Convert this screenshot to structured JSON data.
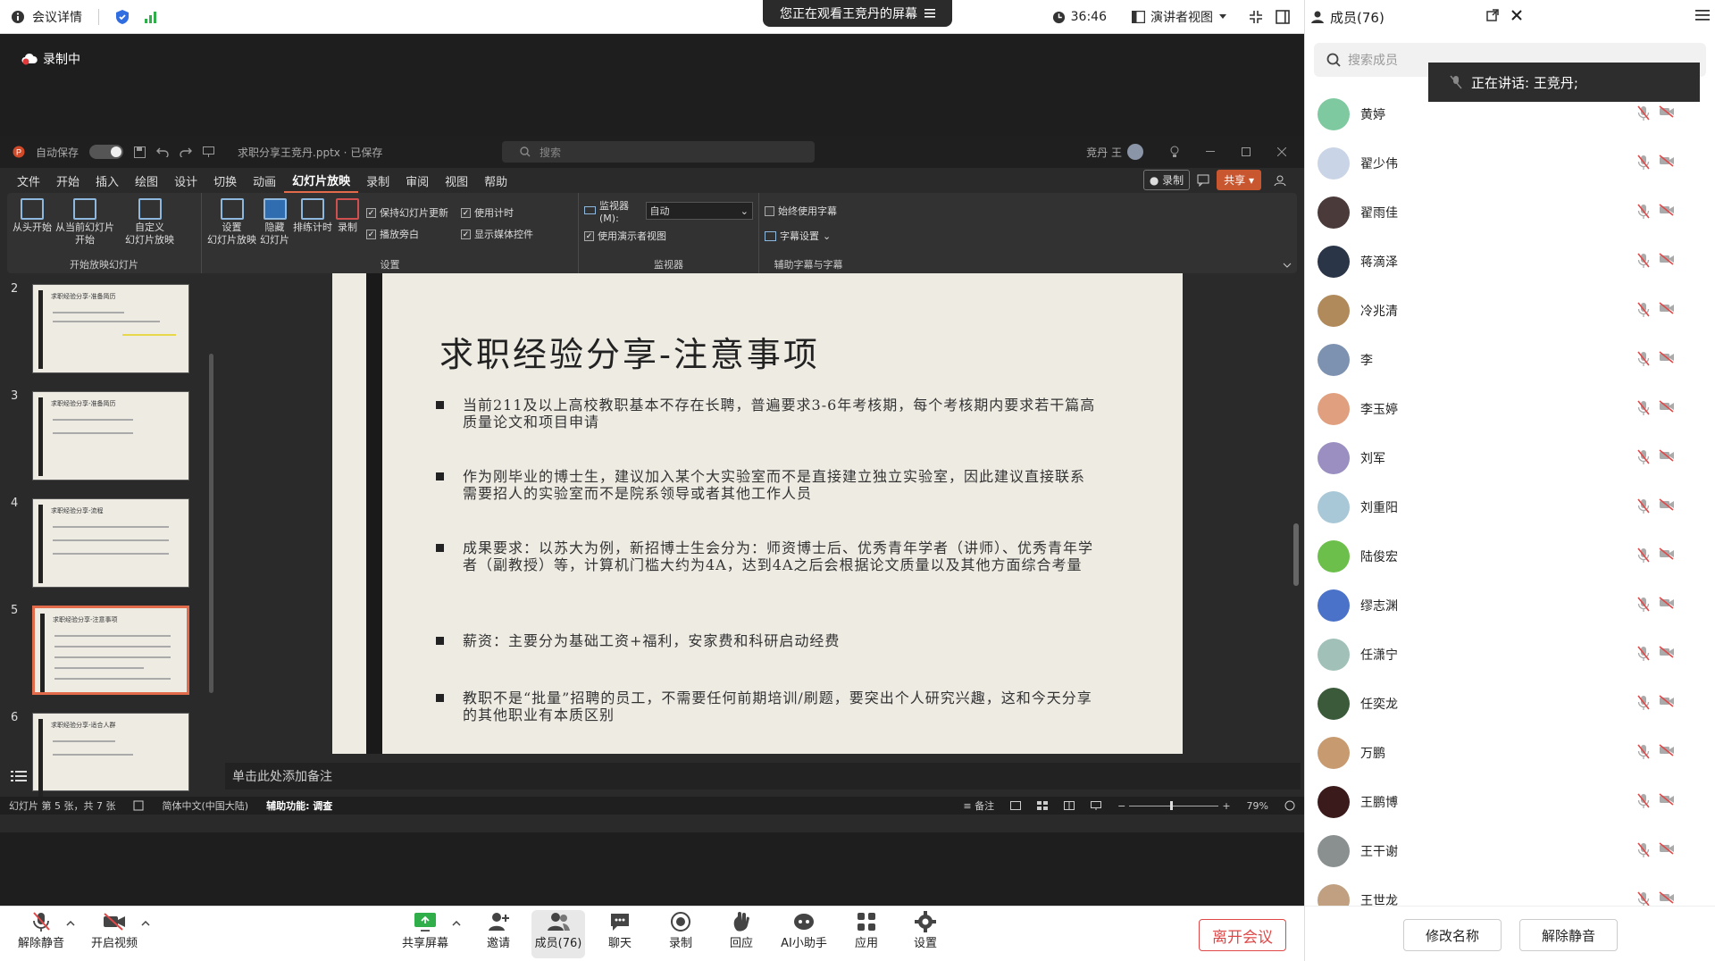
{
  "topbar": {
    "meeting_info": "会议详情",
    "share_banner": "您正在观看王竞丹的屏幕",
    "timer": "36:46",
    "view_mode": "演讲者视图"
  },
  "stage": {
    "recording": "录制中"
  },
  "ppt": {
    "autosave": "自动保存",
    "autosave_state": "开",
    "filename": "求职分享王竞丹.pptx · 已保存",
    "search_placeholder": "搜索",
    "user": "竞丹 王",
    "menu": [
      "文件",
      "开始",
      "插入",
      "绘图",
      "设计",
      "切换",
      "动画",
      "幻灯片放映",
      "录制",
      "审阅",
      "视图",
      "帮助"
    ],
    "active_menu": "幻灯片放映",
    "record_btn": "录制",
    "share_btn": "共享",
    "ribbon": {
      "group1_label": "开始放映幻灯片",
      "from_start": "从头开始",
      "from_current_1": "从当前幻灯片",
      "from_current_2": "开始",
      "custom_1": "自定义",
      "custom_2": "幻灯片放映",
      "setup_1": "设置",
      "setup_2": "幻灯片放映",
      "hide_1": "隐藏",
      "hide_2": "幻灯片",
      "rehearse": "排练计时",
      "record": "录制",
      "keep_updated": "保持幻灯片更新",
      "use_timings": "使用计时",
      "play_narration": "播放旁白",
      "show_media": "显示媒体控件",
      "group2_label": "设置",
      "monitor_label": "监视器(M):",
      "monitor_value": "自动",
      "presenter_view": "使用演示者视图",
      "group3_label": "监视器",
      "always_subtitles": "始终使用字幕",
      "subtitle_settings": "字幕设置",
      "group4_label": "辅助字幕与字幕"
    },
    "thumbnails": [
      {
        "num": "2",
        "title": "求职经验分享-准备简历"
      },
      {
        "num": "3",
        "title": "求职经验分享-准备简历"
      },
      {
        "num": "4",
        "title": "求职经验分享-流程"
      },
      {
        "num": "5",
        "title": "求职经验分享-注意事项"
      },
      {
        "num": "6",
        "title": "求职经验分享-适合人群"
      }
    ],
    "slide": {
      "title": "求职经验分享-注意事项",
      "bullets": [
        "当前211及以上高校教职基本不存在长聘，普遍要求3-6年考核期，每个考核期内要求若干篇高质量论文和项目申请",
        "作为刚毕业的博士生，建议加入某个大实验室而不是直接建立独立实验室，因此建议直接联系需要招人的实验室而不是院系领导或者其他工作人员",
        "成果要求：以苏大为例，新招博士生会分为：师资博士后、优秀青年学者（讲师）、优秀青年学者（副教授）等，计算机门槛大约为4A，达到4A之后会根据论文质量以及其他方面综合考量",
        "薪资：主要分为基础工资+福利，安家费和科研启动经费",
        "教职不是“批量”招聘的员工，不需要任何前期培训/刷题，要突出个人研究兴趣，这和今天分享的其他职业有本质区别"
      ]
    },
    "notes_placeholder": "单击此处添加备注",
    "status": {
      "slide_count": "幻灯片 第 5 张，共 7 张",
      "language": "简体中文(中国大陆)",
      "accessibility": "辅助功能: 调查",
      "notes": "备注",
      "zoom": "79%"
    }
  },
  "toolbar": {
    "unmute": "解除静音",
    "start_video": "开启视频",
    "share_screen": "共享屏幕",
    "invite": "邀请",
    "members": "成员(76)",
    "chat": "聊天",
    "record": "录制",
    "react": "回应",
    "ai_assistant": "AI小助手",
    "apps": "应用",
    "settings": "设置",
    "leave": "离开会议"
  },
  "panel": {
    "title": "成员(76)",
    "search_placeholder": "搜索成员",
    "speaking": "正在讲话:  王竞丹;",
    "members": [
      {
        "name": "黄婷",
        "color": "#7fc9a0"
      },
      {
        "name": "翟少伟",
        "color": "#c9d5e6"
      },
      {
        "name": "翟雨佳",
        "color": "#4a3a3a"
      },
      {
        "name": "蒋滴泽",
        "color": "#2a3548"
      },
      {
        "name": "冷兆清",
        "color": "#b08a5a"
      },
      {
        "name": "李",
        "color": "#7d92b0"
      },
      {
        "name": "李玉婷",
        "color": "#e0a080"
      },
      {
        "name": "刘军",
        "color": "#9a8fc0"
      },
      {
        "name": "刘重阳",
        "color": "#a8c8d8"
      },
      {
        "name": "陆俊宏",
        "color": "#6cbf4a"
      },
      {
        "name": "缪志渊",
        "color": "#4a72c8"
      },
      {
        "name": "任潇宁",
        "color": "#a0c0b8"
      },
      {
        "name": "任奕龙",
        "color": "#3a5a3a"
      },
      {
        "name": "万鹏",
        "color": "#c89a70"
      },
      {
        "name": "王鹏博",
        "color": "#3a1a1a"
      },
      {
        "name": "王干谢",
        "color": "#8a9090"
      },
      {
        "name": "王世龙",
        "color": "#c0a080"
      }
    ],
    "rename": "修改名称",
    "unmute_all": "解除静音"
  }
}
